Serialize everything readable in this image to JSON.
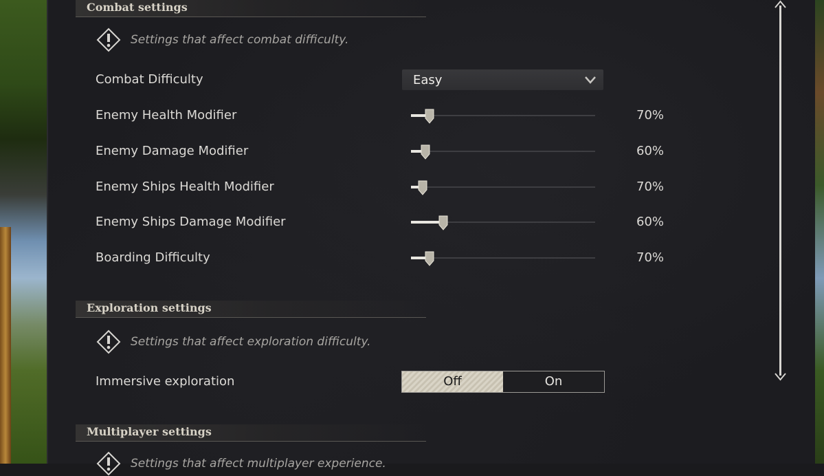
{
  "combat": {
    "header": "Combat settings",
    "hint": "Settings that affect combat difficulty.",
    "difficulty": {
      "label": "Combat Difficulty",
      "value": "Easy"
    },
    "sliders": [
      {
        "label": "Enemy Health Modifier",
        "value_text": "70%",
        "fill": 0.1
      },
      {
        "label": "Enemy Damage Modifier",
        "value_text": "60%",
        "fill": 0.08
      },
      {
        "label": "Enemy Ships Health Modifier",
        "value_text": "70%",
        "fill": 0.065
      },
      {
        "label": "Enemy Ships Damage Modifier",
        "value_text": "60%",
        "fill": 0.175
      },
      {
        "label": "Boarding Difficulty",
        "value_text": "70%",
        "fill": 0.1
      }
    ]
  },
  "exploration": {
    "header": "Exploration settings",
    "hint": "Settings that affect exploration difficulty.",
    "immersive": {
      "label": "Immersive exploration",
      "off": "Off",
      "on": "On",
      "selected": "Off"
    }
  },
  "multiplayer": {
    "header": "Multiplayer settings",
    "hint": "Settings that affect multiplayer experience."
  },
  "colors": {
    "panel": "#1c1c20",
    "text": "#dcdad6",
    "accent": "#e8e6e0"
  },
  "icons": {
    "hint": "warning-diamond-icon",
    "dropdown": "chevron-down-icon",
    "scroll": "scroll-arrow-icon"
  }
}
